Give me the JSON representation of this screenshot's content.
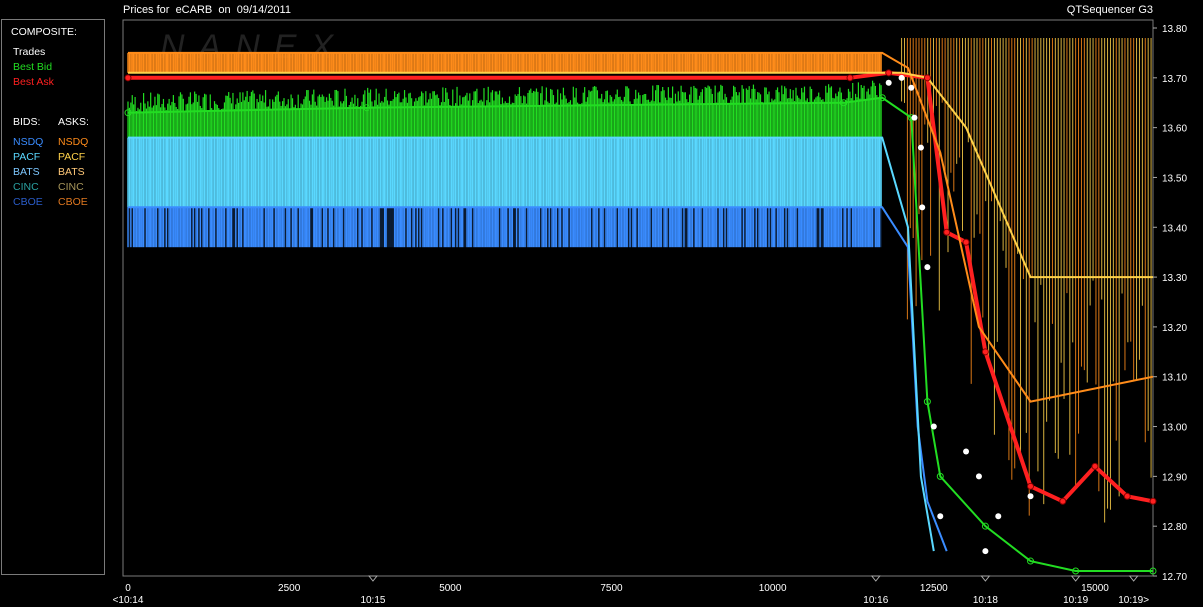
{
  "header": {
    "title": "Prices for  eCARB  on  09/14/2011",
    "app_name": "QTSequencer G3"
  },
  "legend": {
    "composite_label": "COMPOSITE:",
    "composite": [
      {
        "label": "Trades",
        "color": "#ffffff"
      },
      {
        "label": "Best Bid",
        "color": "#22dd22"
      },
      {
        "label": "Best Ask",
        "color": "#ff2020"
      }
    ],
    "bids_label": "BIDS:",
    "asks_label": "ASKS:",
    "bids": [
      {
        "label": "NSDQ",
        "color": "#3a8cff"
      },
      {
        "label": "PACF",
        "color": "#5ad8ff"
      },
      {
        "label": "BATS",
        "color": "#7ec8ff"
      },
      {
        "label": "CINC",
        "color": "#2aa0a0"
      },
      {
        "label": "CBOE",
        "color": "#2a5cc8"
      }
    ],
    "asks": [
      {
        "label": "NSDQ",
        "color": "#ff8c1a"
      },
      {
        "label": "PACF",
        "color": "#ffd24a"
      },
      {
        "label": "BATS",
        "color": "#ffc878"
      },
      {
        "label": "CINC",
        "color": "#a8965a"
      },
      {
        "label": "CBOE",
        "color": "#e07820"
      }
    ]
  },
  "watermark": "NANEX",
  "chart_data": {
    "type": "line",
    "y_ticks": [
      "13.80",
      "13.70",
      "13.60",
      "13.50",
      "13.40",
      "13.30",
      "13.20",
      "13.10",
      "13.00",
      "12.90",
      "12.80",
      "12.70"
    ],
    "ylim": [
      12.7,
      13.8
    ],
    "x_ticks": [
      "0",
      "2500",
      "5000",
      "7500",
      "10000",
      "12500",
      "15000"
    ],
    "xlim": [
      0,
      15900
    ],
    "time_ticks": [
      {
        "label": "<10:14",
        "x": 0
      },
      {
        "label": "10:15",
        "x": 3800
      },
      {
        "label": "10:16",
        "x": 11600
      },
      {
        "label": "10:18",
        "x": 13300
      },
      {
        "label": "10:19",
        "x": 14700
      },
      {
        "label": "10:19>",
        "x": 15600
      }
    ],
    "series": [
      {
        "name": "Best Ask",
        "color": "#ff2020",
        "x": [
          0,
          11200,
          11800,
          12400,
          12700,
          13000,
          13300,
          14000,
          14500,
          15000,
          15500,
          15900
        ],
        "y": [
          13.7,
          13.7,
          13.71,
          13.7,
          13.39,
          13.37,
          13.15,
          12.88,
          12.85,
          12.92,
          12.86,
          12.85
        ]
      },
      {
        "name": "Best Bid",
        "color": "#22dd22",
        "x": [
          0,
          3700,
          11100,
          11700,
          12150,
          12400,
          12600,
          13300,
          14000,
          14700,
          15900
        ],
        "y": [
          13.63,
          13.64,
          13.65,
          13.66,
          13.62,
          13.05,
          12.9,
          12.8,
          12.73,
          12.71,
          12.71
        ]
      },
      {
        "name": "NSDQ Bid",
        "color": "#3a8cff",
        "x": [
          0,
          3700,
          11700,
          12100,
          12250,
          12400,
          12700
        ],
        "y": [
          13.44,
          13.44,
          13.44,
          13.36,
          13.0,
          12.85,
          12.75
        ]
      },
      {
        "name": "PACF Bid",
        "color": "#5ad8ff",
        "x": [
          0,
          11700,
          12100,
          12300,
          12500
        ],
        "y": [
          13.58,
          13.58,
          13.4,
          12.9,
          12.75
        ]
      },
      {
        "name": "NSDQ Ask",
        "color": "#ff8c1a",
        "x": [
          0,
          11700,
          12100,
          12600,
          13200,
          14000,
          15900
        ],
        "y": [
          13.75,
          13.75,
          13.72,
          13.55,
          13.2,
          13.05,
          13.1
        ]
      },
      {
        "name": "PACF Ask",
        "color": "#ffd24a",
        "x": [
          0,
          12000,
          12400,
          13000,
          14000,
          15000,
          15900
        ],
        "y": [
          13.71,
          13.71,
          13.7,
          13.6,
          13.3,
          13.3,
          13.3
        ]
      }
    ],
    "trades": {
      "x": [
        11800,
        12000,
        12150,
        12200,
        12300,
        12320,
        12400,
        12500,
        12600,
        13000,
        13200,
        13300,
        13500,
        14000
      ],
      "y": [
        13.69,
        13.7,
        13.68,
        13.62,
        13.56,
        13.44,
        13.32,
        13.0,
        12.82,
        12.95,
        12.9,
        12.75,
        12.82,
        12.86
      ]
    }
  }
}
